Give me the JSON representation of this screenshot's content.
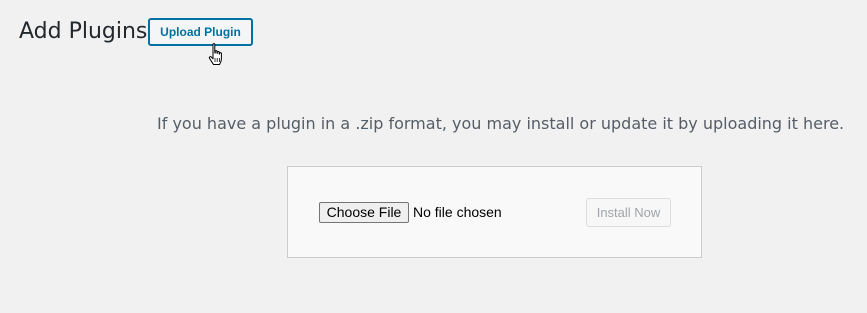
{
  "header": {
    "title": "Add Plugins",
    "upload_button_label": "Upload Plugin"
  },
  "upload": {
    "help_text": "If you have a plugin in a .zip format, you may install or update it by uploading it here.",
    "choose_file_label": "Choose File",
    "file_status": "No file chosen",
    "install_button_label": "Install Now",
    "install_button_disabled": true
  },
  "cursor": {
    "icon": "hand-pointer-icon"
  },
  "colors": {
    "background": "#f1f1f1",
    "accent": "#0071a1",
    "help_text": "#555d66",
    "disabled_text": "#a0a5aa",
    "box_background": "#f9f9f9",
    "box_border": "#cccccc"
  }
}
